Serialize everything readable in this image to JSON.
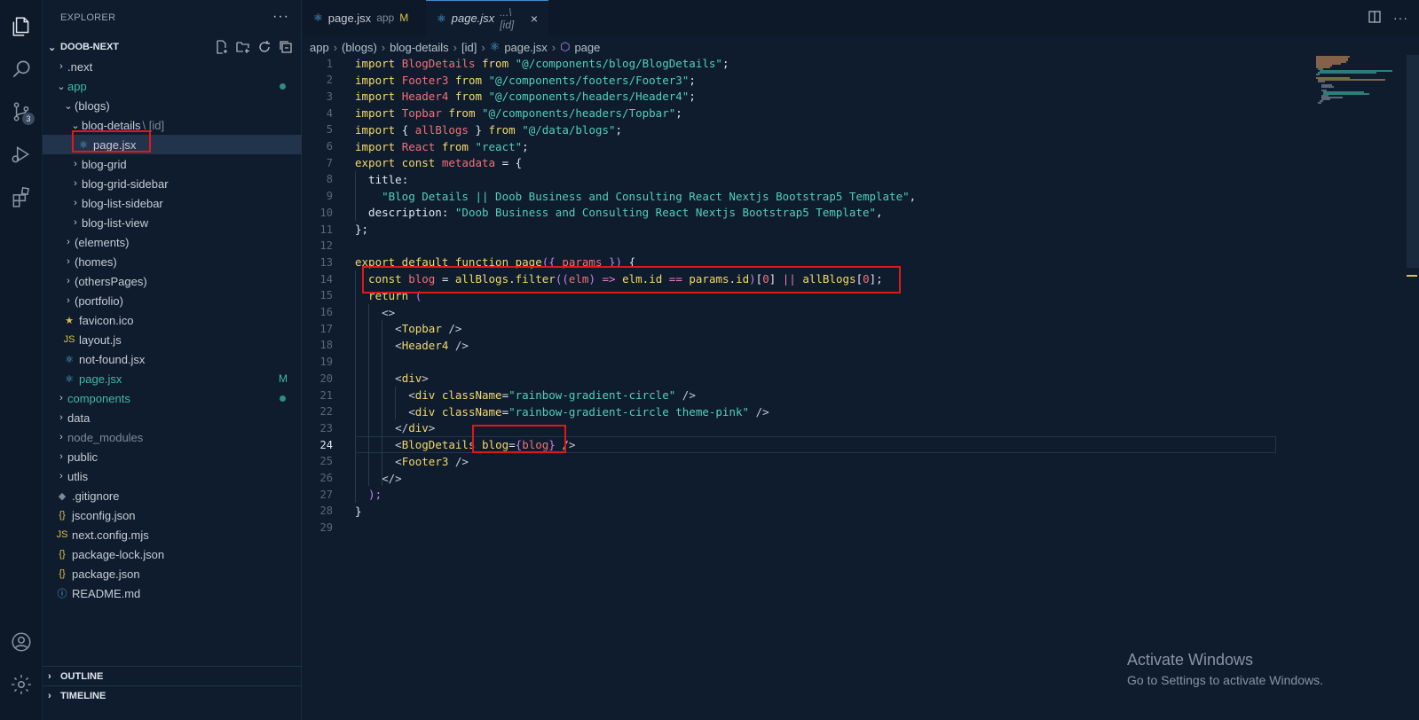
{
  "activity_bar": {
    "items": [
      {
        "name": "explorer-icon"
      },
      {
        "name": "search-icon"
      },
      {
        "name": "source-control-icon",
        "badge": "3"
      },
      {
        "name": "run-debug-icon"
      },
      {
        "name": "extensions-icon"
      }
    ],
    "bottom": [
      {
        "name": "account-icon"
      },
      {
        "name": "settings-gear-icon"
      }
    ]
  },
  "sidebar": {
    "title": "EXPLORER",
    "more": "···",
    "project": "DOOB-NEXT",
    "outline": "OUTLINE",
    "timeline": "TIMELINE",
    "tree": [
      {
        "label": ".next",
        "indent": 1,
        "chev": "›",
        "color": "default"
      },
      {
        "label": "app",
        "indent": 1,
        "chev": "⌄",
        "color": "green",
        "dot": true
      },
      {
        "label": "(blogs)",
        "indent": 2,
        "chev": "⌄",
        "color": "default"
      },
      {
        "label": "blog-details",
        "suffix": "\\ [id]",
        "indent": 3,
        "chev": "⌄",
        "color": "default"
      },
      {
        "label": "page.jsx",
        "indent": 4,
        "icon": "react",
        "color": "default",
        "selected": true
      },
      {
        "label": "blog-grid",
        "indent": 3,
        "chev": "›",
        "color": "default"
      },
      {
        "label": "blog-grid-sidebar",
        "indent": 3,
        "chev": "›",
        "color": "default"
      },
      {
        "label": "blog-list-sidebar",
        "indent": 3,
        "chev": "›",
        "color": "default"
      },
      {
        "label": "blog-list-view",
        "indent": 3,
        "chev": "›",
        "color": "default"
      },
      {
        "label": "(elements)",
        "indent": 2,
        "chev": "›",
        "color": "default"
      },
      {
        "label": "(homes)",
        "indent": 2,
        "chev": "›",
        "color": "default"
      },
      {
        "label": "(othersPages)",
        "indent": 2,
        "chev": "›",
        "color": "default"
      },
      {
        "label": "(portfolio)",
        "indent": 2,
        "chev": "›",
        "color": "default"
      },
      {
        "label": "favicon.ico",
        "indent": 2,
        "icon": "star",
        "color": "default"
      },
      {
        "label": "layout.js",
        "indent": 2,
        "icon": "js",
        "color": "default"
      },
      {
        "label": "not-found.jsx",
        "indent": 2,
        "icon": "react",
        "color": "default"
      },
      {
        "label": "page.jsx",
        "indent": 2,
        "icon": "react",
        "color": "green",
        "deco": "M"
      },
      {
        "label": "components",
        "indent": 1,
        "chev": "›",
        "color": "green",
        "dot": true
      },
      {
        "label": "data",
        "indent": 1,
        "chev": "›",
        "color": "default"
      },
      {
        "label": "node_modules",
        "indent": 1,
        "chev": "›",
        "color": "dim"
      },
      {
        "label": "public",
        "indent": 1,
        "chev": "›",
        "color": "default"
      },
      {
        "label": "utlis",
        "indent": 1,
        "chev": "›",
        "color": "default"
      },
      {
        "label": ".gitignore",
        "indent": 1,
        "icon": "git",
        "color": "default"
      },
      {
        "label": "jsconfig.json",
        "indent": 1,
        "icon": "json",
        "color": "default"
      },
      {
        "label": "next.config.mjs",
        "indent": 1,
        "icon": "js",
        "color": "default"
      },
      {
        "label": "package-lock.json",
        "indent": 1,
        "icon": "json",
        "color": "default"
      },
      {
        "label": "package.json",
        "indent": 1,
        "icon": "json",
        "color": "default"
      },
      {
        "label": "README.md",
        "indent": 1,
        "icon": "info",
        "color": "default"
      }
    ]
  },
  "tabs": [
    {
      "label": "page.jsx",
      "desc": "app",
      "mod": "M",
      "active": false
    },
    {
      "label": "page.jsx",
      "desc": "...\\[id]",
      "close": "×",
      "active": true
    }
  ],
  "breadcrumb": [
    "app",
    "(blogs)",
    "blog-details",
    "[id]",
    "page.jsx",
    "page"
  ],
  "editor": {
    "current_line": 24,
    "lines": [
      [
        [
          "kw",
          "import "
        ],
        [
          "id",
          "BlogDetails"
        ],
        [
          "kw",
          " from "
        ],
        [
          "str",
          "\"@/components/blog/BlogDetails\""
        ],
        [
          "pl",
          ";"
        ]
      ],
      [
        [
          "kw",
          "import "
        ],
        [
          "id",
          "Footer3"
        ],
        [
          "kw",
          " from "
        ],
        [
          "str",
          "\"@/components/footers/Footer3\""
        ],
        [
          "pl",
          ";"
        ]
      ],
      [
        [
          "kw",
          "import "
        ],
        [
          "id",
          "Header4"
        ],
        [
          "kw",
          " from "
        ],
        [
          "str",
          "\"@/components/headers/Header4\""
        ],
        [
          "pl",
          ";"
        ]
      ],
      [
        [
          "kw",
          "import "
        ],
        [
          "id",
          "Topbar"
        ],
        [
          "kw",
          " from "
        ],
        [
          "str",
          "\"@/components/headers/Topbar\""
        ],
        [
          "pl",
          ";"
        ]
      ],
      [
        [
          "kw",
          "import "
        ],
        [
          "pl",
          "{ "
        ],
        [
          "id",
          "allBlogs"
        ],
        [
          "pl",
          " } "
        ],
        [
          "kw",
          "from "
        ],
        [
          "str",
          "\"@/data/blogs\""
        ],
        [
          "pl",
          ";"
        ]
      ],
      [
        [
          "kw",
          "import "
        ],
        [
          "id",
          "React"
        ],
        [
          "kw",
          " from "
        ],
        [
          "str",
          "\"react\""
        ],
        [
          "pl",
          ";"
        ]
      ],
      [
        [
          "kw",
          "export const "
        ],
        [
          "id",
          "metadata"
        ],
        [
          "pl",
          " = {"
        ]
      ],
      [
        [
          "pl",
          "  title"
        ],
        [
          "pl",
          ":"
        ]
      ],
      [
        [
          "str",
          "    \"Blog Details || Doob Business and Consulting React Nextjs Bootstrap5 Template\""
        ],
        [
          "pl",
          ","
        ]
      ],
      [
        [
          "pl",
          "  description"
        ],
        [
          "pl",
          ": "
        ],
        [
          "str",
          "\"Doob Business and Consulting React Nextjs Bootstrap5 Template\""
        ],
        [
          "pl",
          ","
        ]
      ],
      [
        [
          "pl",
          "};"
        ]
      ],
      [
        [
          "pl",
          ""
        ]
      ],
      [
        [
          "kw",
          "export default function "
        ],
        [
          "kw",
          "page"
        ],
        [
          "br",
          "({ "
        ],
        [
          "id",
          "params"
        ],
        [
          "br",
          " })"
        ],
        [
          "pl",
          " {"
        ]
      ],
      [
        [
          "kw",
          "  const "
        ],
        [
          "id",
          "blog"
        ],
        [
          "pl",
          " = "
        ],
        [
          "kw",
          "allBlogs"
        ],
        [
          "pl",
          "."
        ],
        [
          "kw",
          "filter"
        ],
        [
          "br",
          "(("
        ],
        [
          "id",
          "elm"
        ],
        [
          "br",
          ")"
        ],
        [
          "op",
          " => "
        ],
        [
          "kw",
          "elm"
        ],
        [
          "pl",
          "."
        ],
        [
          "kw",
          "id"
        ],
        [
          "op",
          " == "
        ],
        [
          "kw",
          "params"
        ],
        [
          "pl",
          "."
        ],
        [
          "kw",
          "id"
        ],
        [
          "br",
          ")"
        ],
        [
          "pl",
          "["
        ],
        [
          "id",
          "0"
        ],
        [
          "pl",
          "]"
        ],
        [
          "op",
          " || "
        ],
        [
          "kw",
          "allBlogs"
        ],
        [
          "pl",
          "["
        ],
        [
          "id",
          "0"
        ],
        [
          "pl",
          "];"
        ]
      ],
      [
        [
          "kw",
          "  return "
        ],
        [
          "br",
          "("
        ]
      ],
      [
        [
          "tag",
          "    <>"
        ]
      ],
      [
        [
          "tag",
          "      <"
        ],
        [
          "tn",
          "Topbar"
        ],
        [
          "tag",
          " />"
        ]
      ],
      [
        [
          "tag",
          "      <"
        ],
        [
          "tn",
          "Header4"
        ],
        [
          "tag",
          " />"
        ]
      ],
      [
        [
          "pl",
          ""
        ]
      ],
      [
        [
          "tag",
          "      <"
        ],
        [
          "tn",
          "div"
        ],
        [
          "tag",
          ">"
        ]
      ],
      [
        [
          "tag",
          "        <"
        ],
        [
          "tn",
          "div"
        ],
        [
          "pl",
          " "
        ],
        [
          "attr",
          "className"
        ],
        [
          "pl",
          "="
        ],
        [
          "str",
          "\"rainbow-gradient-circle\""
        ],
        [
          "tag",
          " />"
        ]
      ],
      [
        [
          "tag",
          "        <"
        ],
        [
          "tn",
          "div"
        ],
        [
          "pl",
          " "
        ],
        [
          "attr",
          "className"
        ],
        [
          "pl",
          "="
        ],
        [
          "str",
          "\"rainbow-gradient-circle theme-pink\""
        ],
        [
          "tag",
          " />"
        ]
      ],
      [
        [
          "tag",
          "      </"
        ],
        [
          "tn",
          "div"
        ],
        [
          "tag",
          ">"
        ]
      ],
      [
        [
          "tag",
          "      <"
        ],
        [
          "tn",
          "BlogDetails"
        ],
        [
          "pl",
          " "
        ],
        [
          "attr",
          "blog"
        ],
        [
          "pl",
          "="
        ],
        [
          "br",
          "{"
        ],
        [
          "id",
          "blog"
        ],
        [
          "br",
          "}"
        ],
        [
          "tag",
          " />"
        ]
      ],
      [
        [
          "tag",
          "      <"
        ],
        [
          "tn",
          "Footer3"
        ],
        [
          "tag",
          " />"
        ]
      ],
      [
        [
          "tag",
          "    </>"
        ]
      ],
      [
        [
          "br",
          "  );"
        ]
      ],
      [
        [
          "pl",
          "}"
        ]
      ],
      [
        [
          "pl",
          ""
        ]
      ]
    ]
  },
  "watermark": {
    "line1": "Activate Windows",
    "line2": "Go to Settings to activate Windows."
  },
  "colors": {
    "background": "#0f1c2e",
    "highlight": "#e01818",
    "accent": "#3b8fd1"
  }
}
